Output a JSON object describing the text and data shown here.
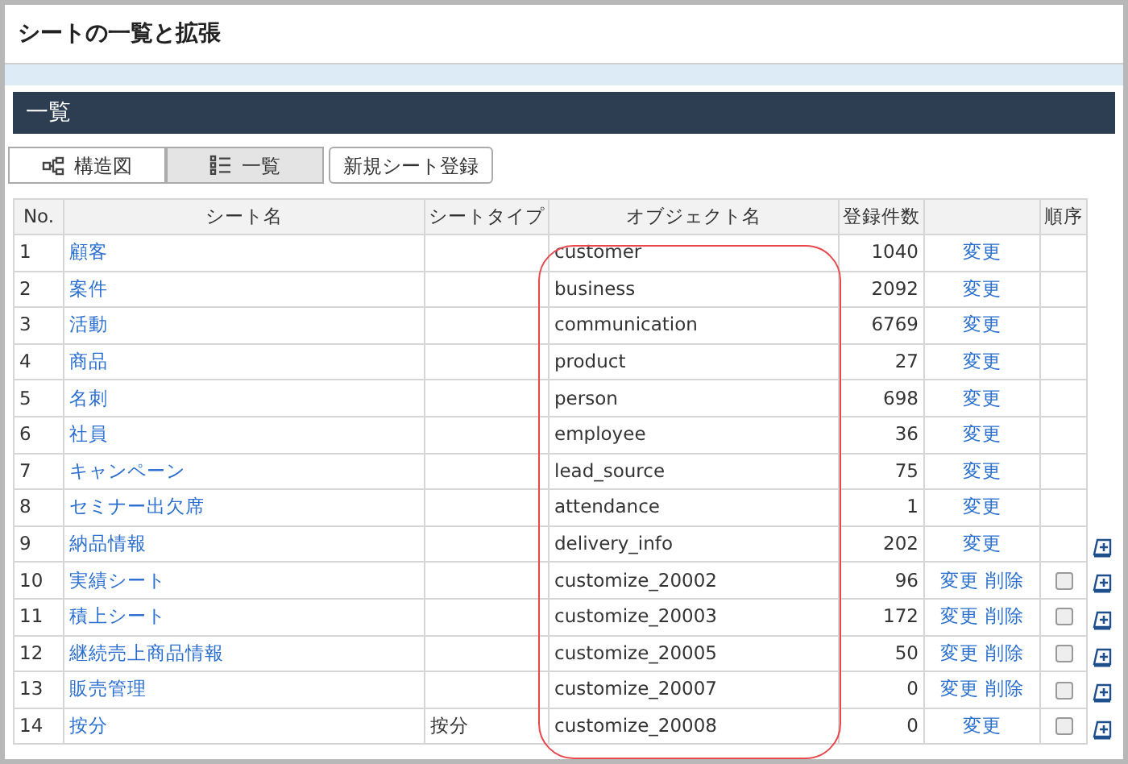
{
  "page_title": "シートの一覧と拡張",
  "section_title": "一覧",
  "view_tabs": [
    {
      "label": "構造図",
      "kind": "diagram",
      "selected": false
    },
    {
      "label": "一覧",
      "kind": "list",
      "selected": true
    }
  ],
  "new_sheet_button": "新規シート登録",
  "table": {
    "columns": [
      "No.",
      "シート名",
      "シートタイプ",
      "オブジェクト名",
      "登録件数",
      "順序"
    ],
    "rows": [
      {
        "no": "1",
        "sheet_name": "顧客",
        "sheet_type": "",
        "object_name": "customer",
        "count": "1040",
        "actions": [
          "変更"
        ],
        "order_icon": false
      },
      {
        "no": "2",
        "sheet_name": "案件",
        "sheet_type": "",
        "object_name": "business",
        "count": "2092",
        "actions": [
          "変更"
        ],
        "order_icon": false
      },
      {
        "no": "3",
        "sheet_name": "活動",
        "sheet_type": "",
        "object_name": "communication",
        "count": "6769",
        "actions": [
          "変更"
        ],
        "order_icon": false
      },
      {
        "no": "4",
        "sheet_name": "商品",
        "sheet_type": "",
        "object_name": "product",
        "count": "27",
        "actions": [
          "変更"
        ],
        "order_icon": false
      },
      {
        "no": "5",
        "sheet_name": "名刺",
        "sheet_type": "",
        "object_name": "person",
        "count": "698",
        "actions": [
          "変更"
        ],
        "order_icon": false
      },
      {
        "no": "6",
        "sheet_name": "社員",
        "sheet_type": "",
        "object_name": "employee",
        "count": "36",
        "actions": [
          "変更"
        ],
        "order_icon": false
      },
      {
        "no": "7",
        "sheet_name": "キャンペーン",
        "sheet_type": "",
        "object_name": "lead_source",
        "count": "75",
        "actions": [
          "変更"
        ],
        "order_icon": false
      },
      {
        "no": "8",
        "sheet_name": "セミナー出欠席",
        "sheet_type": "",
        "object_name": "attendance",
        "count": "1",
        "actions": [
          "変更"
        ],
        "order_icon": false
      },
      {
        "no": "9",
        "sheet_name": "納品情報",
        "sheet_type": "",
        "object_name": "delivery_info",
        "count": "202",
        "actions": [
          "変更"
        ],
        "order_icon": true
      },
      {
        "no": "10",
        "sheet_name": "実績シート",
        "sheet_type": "",
        "object_name": "customize_20002",
        "count": "96",
        "actions": [
          "変更",
          "削除"
        ],
        "checked": false,
        "order_icon": true
      },
      {
        "no": "11",
        "sheet_name": "積上シート",
        "sheet_type": "",
        "object_name": "customize_20003",
        "count": "172",
        "actions": [
          "変更",
          "削除"
        ],
        "checked": false,
        "order_icon": true
      },
      {
        "no": "12",
        "sheet_name": "継続売上商品情報",
        "sheet_type": "",
        "object_name": "customize_20005",
        "count": "50",
        "actions": [
          "変更",
          "削除"
        ],
        "checked": false,
        "order_icon": true
      },
      {
        "no": "13",
        "sheet_name": "販売管理",
        "sheet_type": "",
        "object_name": "customize_20007",
        "count": "0",
        "actions": [
          "変更",
          "削除"
        ],
        "checked": false,
        "order_icon": true
      },
      {
        "no": "14",
        "sheet_name": "按分",
        "sheet_type": "按分",
        "object_name": "customize_20008",
        "count": "0",
        "actions": [
          "変更"
        ],
        "checked": false,
        "order_icon": true
      }
    ]
  }
}
